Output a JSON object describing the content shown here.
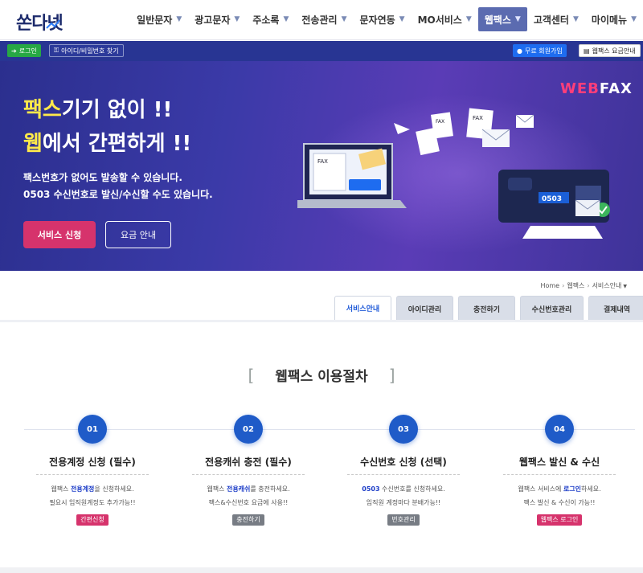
{
  "header": {
    "logo": "쏜다넷",
    "nav": [
      {
        "label": "일반문자"
      },
      {
        "label": "광고문자"
      },
      {
        "label": "주소록"
      },
      {
        "label": "전송관리"
      },
      {
        "label": "문자연동"
      },
      {
        "label": "MO서비스"
      },
      {
        "label": "웹팩스",
        "active": true
      },
      {
        "label": "고객센터"
      },
      {
        "label": "마이메뉴"
      }
    ]
  },
  "subbar": {
    "login": "로그인",
    "find": "아이디/비밀번호 찾기",
    "join": "무료 회원가입",
    "fee": "웹팩스 요금안내"
  },
  "hero": {
    "line1_highlight": "팩스",
    "line1_rest": "기기 없이 !!",
    "line2_highlight": "웹",
    "line2_rest": "에서 간편하게 !!",
    "desc1": "팩스번호가 없어도 발송할 수 있습니다.",
    "desc2": "0503 수신번호로 발신/수신할 수도 있습니다.",
    "apply_button": "서비스 신청",
    "price_button": "요금 안내",
    "brand_web": "WEB",
    "brand_fax": "FAX",
    "art": {
      "fax_label": "FAX",
      "number": "0503"
    }
  },
  "breadcrumb": {
    "home": "Home",
    "section": "웹팩스",
    "current": "서비스안내"
  },
  "tabs": [
    {
      "label": "서비스안내",
      "active": true
    },
    {
      "label": "아이디관리"
    },
    {
      "label": "충전하기"
    },
    {
      "label": "수신번호관리"
    },
    {
      "label": "결제내역"
    }
  ],
  "procedure": {
    "title": "웹팩스 이용절차",
    "steps": [
      {
        "num": "01",
        "title": "전용계정 신청 (필수)",
        "d1_pre": "웹팩스 ",
        "d1_b": "전용계정",
        "d1_post": "을 신청하세요.",
        "d2": "필요시 임직원계정도 추가가능!!",
        "button": "간편신청",
        "button_color": "#d6336c"
      },
      {
        "num": "02",
        "title": "전용캐쉬 충전 (필수)",
        "d1_pre": "웹팩스 ",
        "d1_b": "전용캐쉬",
        "d1_post": "를 충전하세요.",
        "d2": "팩스&수신번호 요금에 사용!!",
        "button": "충전하기",
        "button_color": "#777c84"
      },
      {
        "num": "03",
        "title": "수신번호 신청 (선택)",
        "d1_pre": "",
        "d1_b": "0503",
        "d1_post": " 수신번호를 신청하세요.",
        "d2": "임직원 계정마다 분배가능!!",
        "button": "번호관리",
        "button_color": "#777c84"
      },
      {
        "num": "04",
        "title": "웹팩스 발신 & 수신",
        "d1_pre": "웹팩스 서비스에 ",
        "d1_b": "로그인",
        "d1_post": "하세요.",
        "d2": "팩스 발신 & 수신이 가능!!",
        "button": "웹팩스 로그인",
        "button_color": "#d6336c"
      }
    ]
  }
}
